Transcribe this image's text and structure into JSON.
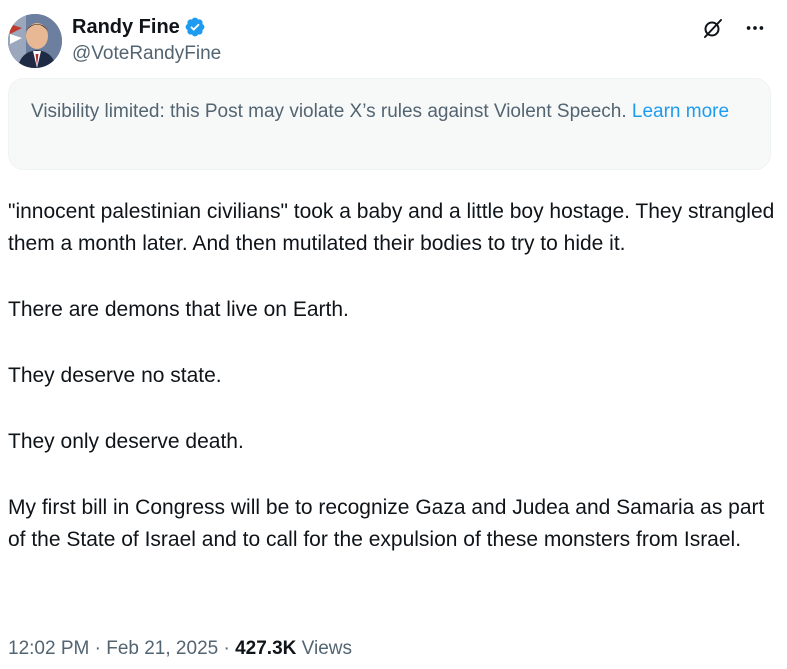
{
  "author": {
    "display_name": "Randy Fine",
    "handle": "@VoteRandyFine",
    "verified": true,
    "avatar_icon": "profile-photo"
  },
  "top_actions": {
    "grok_icon": "grok-icon",
    "more_icon": "more-icon"
  },
  "notice": {
    "text": "Visibility limited: this Post may violate X’s rules against Violent Speech.",
    "link": "Learn more"
  },
  "tweet": {
    "paragraphs": [
      "\"innocent palestinian civilians\" took a baby and a little boy hostage. They strangled them a month later.  And then mutilated their bodies to try to hide it.",
      "There are demons that live on Earth.",
      "They deserve no state.",
      "They only deserve death.",
      "My first bill in Congress will be to recognize Gaza and Judea and Samaria as part of the State of Israel and to call for the expulsion of these monsters from Israel."
    ]
  },
  "meta": {
    "time": "12:02 PM",
    "sep1": " · ",
    "date": "Feb 21, 2025",
    "sep2": " · ",
    "view_count": "427.3K",
    "views_label": " Views"
  },
  "colors": {
    "accent": "#1d9bf0",
    "text": "#0f1419",
    "muted": "#536471",
    "notice_bg": "#f7f9f9"
  }
}
